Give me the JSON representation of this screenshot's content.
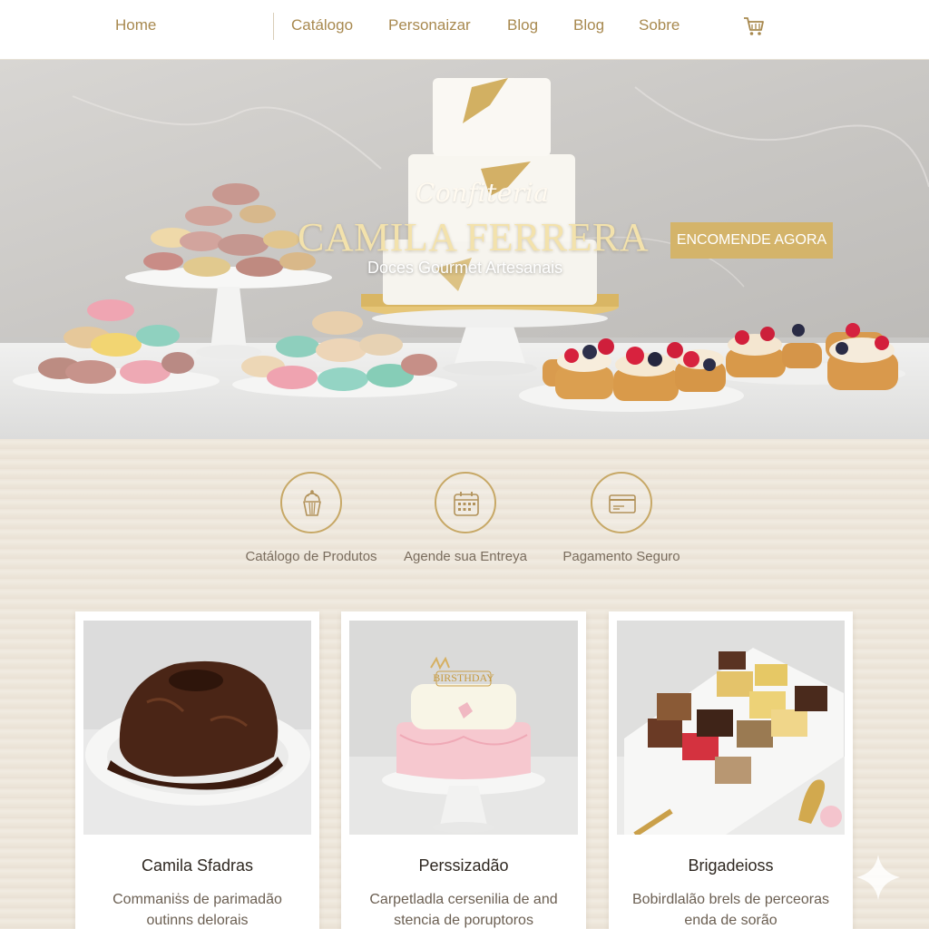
{
  "nav": {
    "items": [
      "Home",
      "Catálogo",
      "Personaizar",
      "Blog",
      "Blog",
      "Sobre"
    ],
    "cart_icon": "cart-icon"
  },
  "hero": {
    "script": "Confiteria",
    "title": "CAMILA FERRERA",
    "subtitle": "Doces Gourmet Artesanais",
    "cta": "ENCOMENDE AGORA"
  },
  "features": [
    {
      "label": "Catálogo de Produtos",
      "icon": "cupcake-icon"
    },
    {
      "label": "Agende sua Entreya",
      "icon": "calendar-icon"
    },
    {
      "label": "Pagamento Seguro",
      "icon": "credit-card-icon"
    }
  ],
  "cards": [
    {
      "title": "Camila Sfadras",
      "desc": "Commaniṡs de parimadão outinns delorais"
    },
    {
      "title": "Perssizadão",
      "desc": "Carpetladla cersenilia de and stencia de poruptoros"
    },
    {
      "title": "Brigadeioss",
      "desc": "Bobirdlalão brels de perceoras enda de sorão"
    }
  ],
  "cake_topper": "BIRSTHDAY",
  "colors": {
    "gold": "#c7a866",
    "cta": "#d4b46a",
    "nav_text": "#a8894f",
    "background": "#ede6da"
  }
}
